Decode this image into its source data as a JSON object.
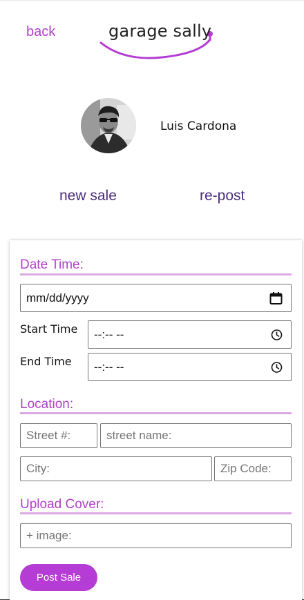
{
  "header": {
    "back_label": "back",
    "logo_text": "garage sally"
  },
  "profile": {
    "name": "Luis Cardona"
  },
  "tabs": {
    "new_sale": "new sale",
    "repost": "re-post"
  },
  "form": {
    "date_time": {
      "title": "Date Time:",
      "date_value": "mm/dd/yyyy",
      "start_label": "Start Time",
      "start_value": "--:-- --",
      "end_label": "End Time",
      "end_value": "--:-- --"
    },
    "location": {
      "title": "Location:",
      "street_number_placeholder": "Street #:",
      "street_name_placeholder": "street name:",
      "city_placeholder": "City:",
      "zip_placeholder": "Zip Code:"
    },
    "upload": {
      "title": "Upload Cover:",
      "image_placeholder": "+ image:"
    },
    "submit_label": "Post Sale"
  },
  "colors": {
    "accent": "#b03fc8",
    "accent_light": "#dca8e4",
    "tab_text": "#4a2e7a",
    "button": "#b53cd4"
  },
  "icons": {
    "date_picker": "calendar-icon",
    "time_picker": "clock-icon"
  }
}
